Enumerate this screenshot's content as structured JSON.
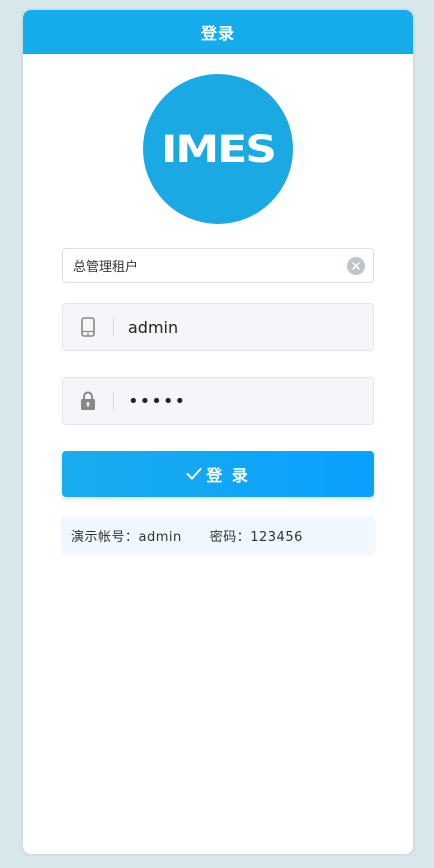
{
  "header": {
    "title": "登录"
  },
  "logo": {
    "text": "IMES",
    "color": "#1aa9e3"
  },
  "tenant": {
    "value": "总管理租户"
  },
  "username": {
    "value": "admin",
    "icon": "phone-icon"
  },
  "password": {
    "value": "•••••",
    "icon": "lock-icon"
  },
  "login_button": {
    "label": "登 录",
    "icon": "check-icon"
  },
  "hint": {
    "account": "演示帐号：admin",
    "password": "密码：123456"
  },
  "colors": {
    "accent": "#16acec",
    "background": "#d7e7eb"
  }
}
